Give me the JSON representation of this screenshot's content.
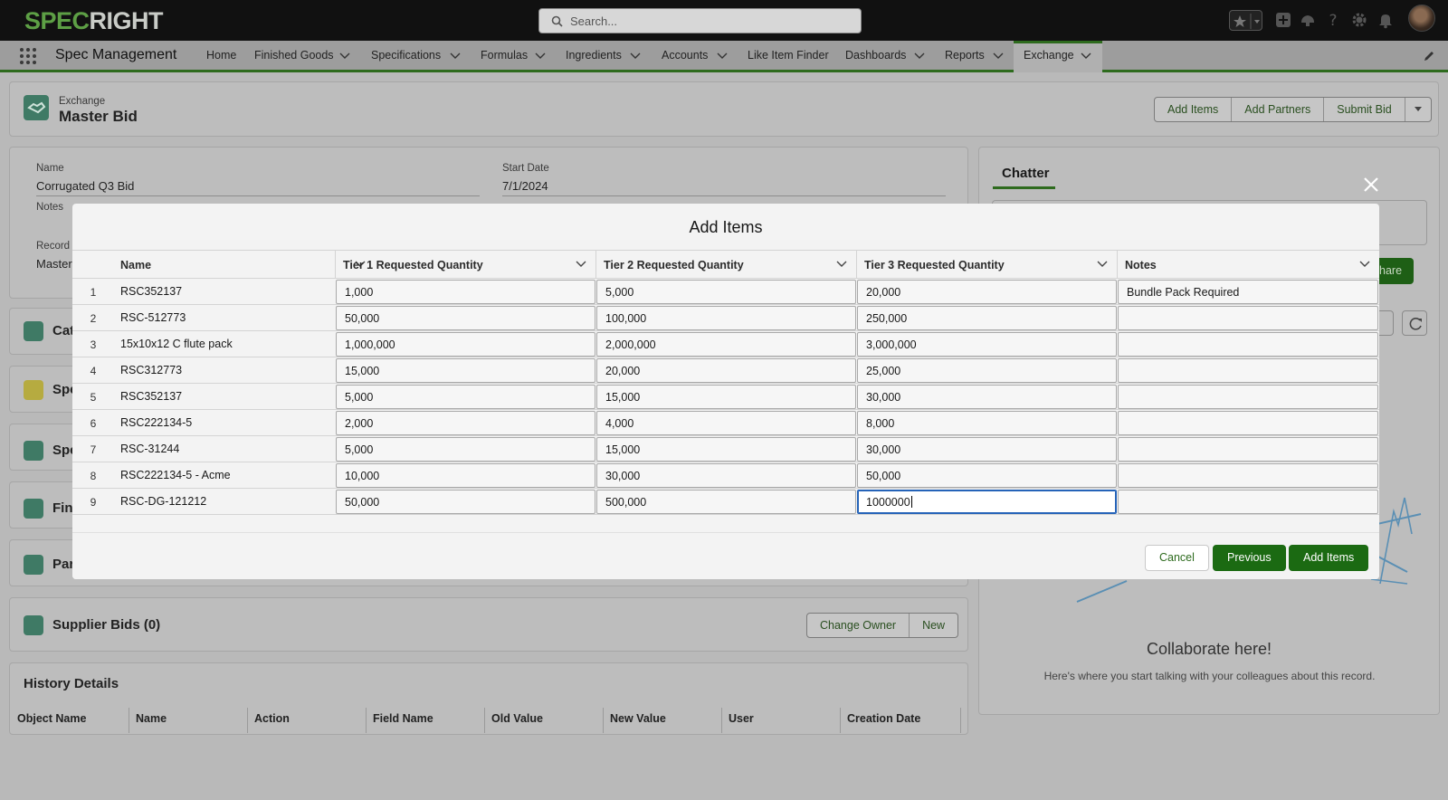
{
  "header": {
    "logo_left": "SPEC",
    "logo_right": "RIGHT",
    "search_placeholder": "Search..."
  },
  "nav": {
    "app_name": "Spec Management",
    "items": [
      "Home",
      "Finished Goods",
      "Specifications",
      "Formulas",
      "Ingredients",
      "Accounts",
      "Like Item Finder",
      "Dashboards",
      "Reports",
      "Exchange"
    ]
  },
  "record": {
    "object_label": "Exchange",
    "title": "Master Bid",
    "actions": [
      "Add Items",
      "Add Partners",
      "Submit Bid"
    ],
    "fields": {
      "name_label": "Name",
      "name_value": "Corrugated Q3 Bid",
      "start_date_label": "Start Date",
      "start_date_value": "7/1/2024",
      "notes_label": "Notes",
      "record_label": "Record",
      "record_value": "Master"
    },
    "related": [
      "Cat",
      "Spe",
      "Spe",
      "Fin",
      "Par"
    ],
    "supplier_bids": {
      "title": "Supplier Bids (0)",
      "actions": [
        "Change Owner",
        "New"
      ]
    },
    "history": {
      "title": "History Details",
      "columns": [
        "Object Name",
        "Name",
        "Action",
        "Field Name",
        "Old Value",
        "New Value",
        "User",
        "Creation Date"
      ]
    }
  },
  "chatter": {
    "title": "Chatter",
    "share_fragment": "hare",
    "collab_title": "Collaborate here!",
    "collab_subtitle": "Here's where you start talking with your colleagues about this record."
  },
  "modal": {
    "title": "Add Items",
    "columns": [
      "Name",
      "Tier 1 Requested Quantity",
      "Tier 2 Requested Quantity",
      "Tier 3 Requested Quantity",
      "Notes"
    ],
    "rows": [
      {
        "n": "1",
        "name": "RSC352137",
        "t1": "1,000",
        "t2": "5,000",
        "t3": "20,000",
        "notes": "Bundle Pack Required"
      },
      {
        "n": "2",
        "name": "RSC-512773",
        "t1": "50,000",
        "t2": "100,000",
        "t3": "250,000",
        "notes": ""
      },
      {
        "n": "3",
        "name": "15x10x12 C flute pack",
        "t1": "1,000,000",
        "t2": "2,000,000",
        "t3": "3,000,000",
        "notes": ""
      },
      {
        "n": "4",
        "name": "RSC312773",
        "t1": "15,000",
        "t2": "20,000",
        "t3": "25,000",
        "notes": ""
      },
      {
        "n": "5",
        "name": "RSC352137",
        "t1": "5,000",
        "t2": "15,000",
        "t3": "30,000",
        "notes": ""
      },
      {
        "n": "6",
        "name": "RSC222134-5",
        "t1": "2,000",
        "t2": "4,000",
        "t3": "8,000",
        "notes": ""
      },
      {
        "n": "7",
        "name": "RSC-31244",
        "t1": "5,000",
        "t2": "15,000",
        "t3": "30,000",
        "notes": ""
      },
      {
        "n": "8",
        "name": "RSC222134-5 - Acme",
        "t1": "10,000",
        "t2": "30,000",
        "t3": "50,000",
        "notes": ""
      },
      {
        "n": "9",
        "name": "RSC-DG-121212",
        "t1": "50,000",
        "t2": "500,000",
        "t3": "1000000",
        "notes": ""
      }
    ],
    "buttons": {
      "cancel": "Cancel",
      "previous": "Previous",
      "add": "Add Items"
    }
  },
  "colors": {
    "brand": "#1b6a12",
    "accent_green": "#2e6b1e",
    "focus_blue": "#2563b8"
  }
}
